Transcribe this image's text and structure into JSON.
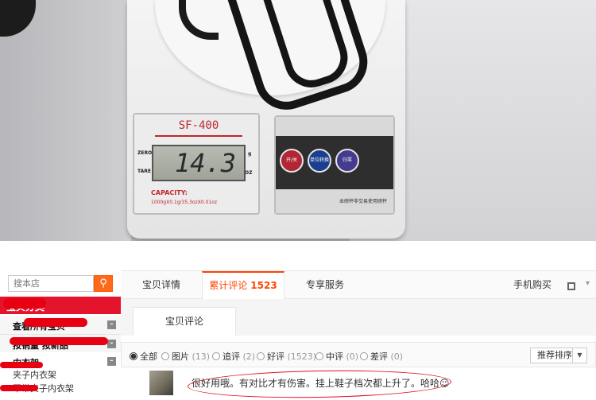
{
  "photo": {
    "scale_model": "SF-400",
    "display_value": "14.3",
    "zero_label": "ZERO",
    "tare_label": "TARE",
    "unit_g": "g",
    "unit_oz": "OZ",
    "capacity_label": "CAPACITY:",
    "capacity_spec": "1000gX0.1g/35.3ozX0.01oz",
    "buttons": [
      "开/关",
      "单位转换",
      "归零"
    ],
    "footer_text": "本磅秤非交易使用磅秤"
  },
  "sidebar": {
    "search_placeholder": "搜本店",
    "search_icon": "search-icon",
    "category_header": "宝贝分类",
    "categories": [
      {
        "label": "查看所有宝贝",
        "toggle": "-"
      },
      {
        "label": "按销量 按新品",
        "toggle": "-"
      },
      {
        "label": "内衣架",
        "toggle": "-"
      }
    ],
    "sub_items": [
      "夹子内衣架",
      "不带夹子内衣架"
    ]
  },
  "tabs": {
    "detail": "宝贝详情",
    "reviews_label": "累计评论",
    "reviews_count": "1523",
    "service": "专享服务",
    "mobile": "手机购买"
  },
  "subtab": {
    "label": "宝贝评论"
  },
  "filters": [
    {
      "label": "全部",
      "count": "",
      "selected": true
    },
    {
      "label": "图片",
      "count": "(13)",
      "selected": false
    },
    {
      "label": "追评",
      "count": "(2)",
      "selected": false
    },
    {
      "label": "好评",
      "count": "(1523)",
      "selected": false
    },
    {
      "label": "中评",
      "count": "(0)",
      "selected": false
    },
    {
      "label": "差评",
      "count": "(0)",
      "selected": false
    }
  ],
  "sort": {
    "label": "推荐排序"
  },
  "review": {
    "text": "很好用哦。有对比才有伤害。挂上鞋子档次都上升了。哈哈☺"
  },
  "colors": {
    "accent": "#ff4400",
    "category_red": "#e4142c",
    "search_orange": "#ff6a1a"
  }
}
